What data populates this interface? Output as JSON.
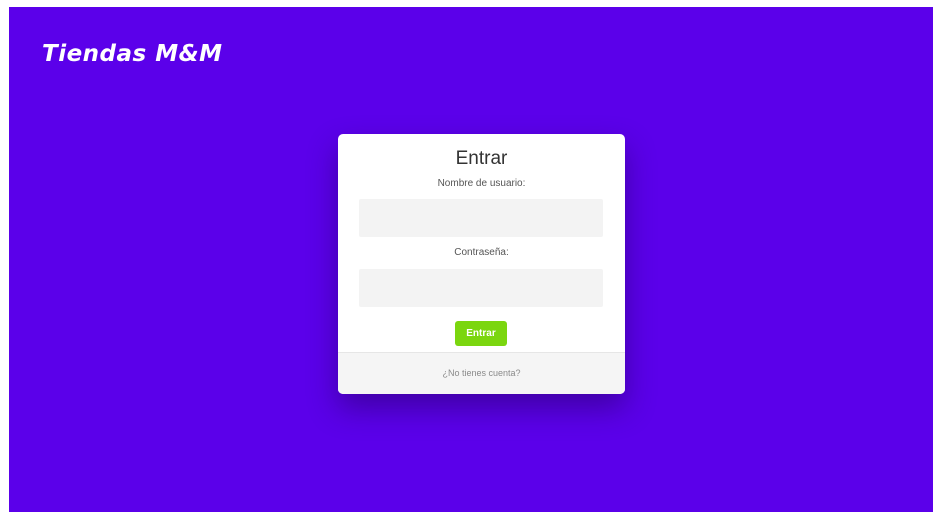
{
  "brand": {
    "title": "Tiendas M&M"
  },
  "login": {
    "title": "Entrar",
    "username_label": "Nombre de usuario:",
    "username_value": "",
    "password_label": "Contraseña:",
    "password_value": "",
    "submit_label": "Entrar",
    "footer_link": "¿No tienes cuenta?"
  },
  "colors": {
    "background": "#5b00ea",
    "card": "#ffffff",
    "submit_button": "#7bd60f",
    "input_background": "#f3f3f3",
    "footer_background": "#f5f5f5"
  }
}
